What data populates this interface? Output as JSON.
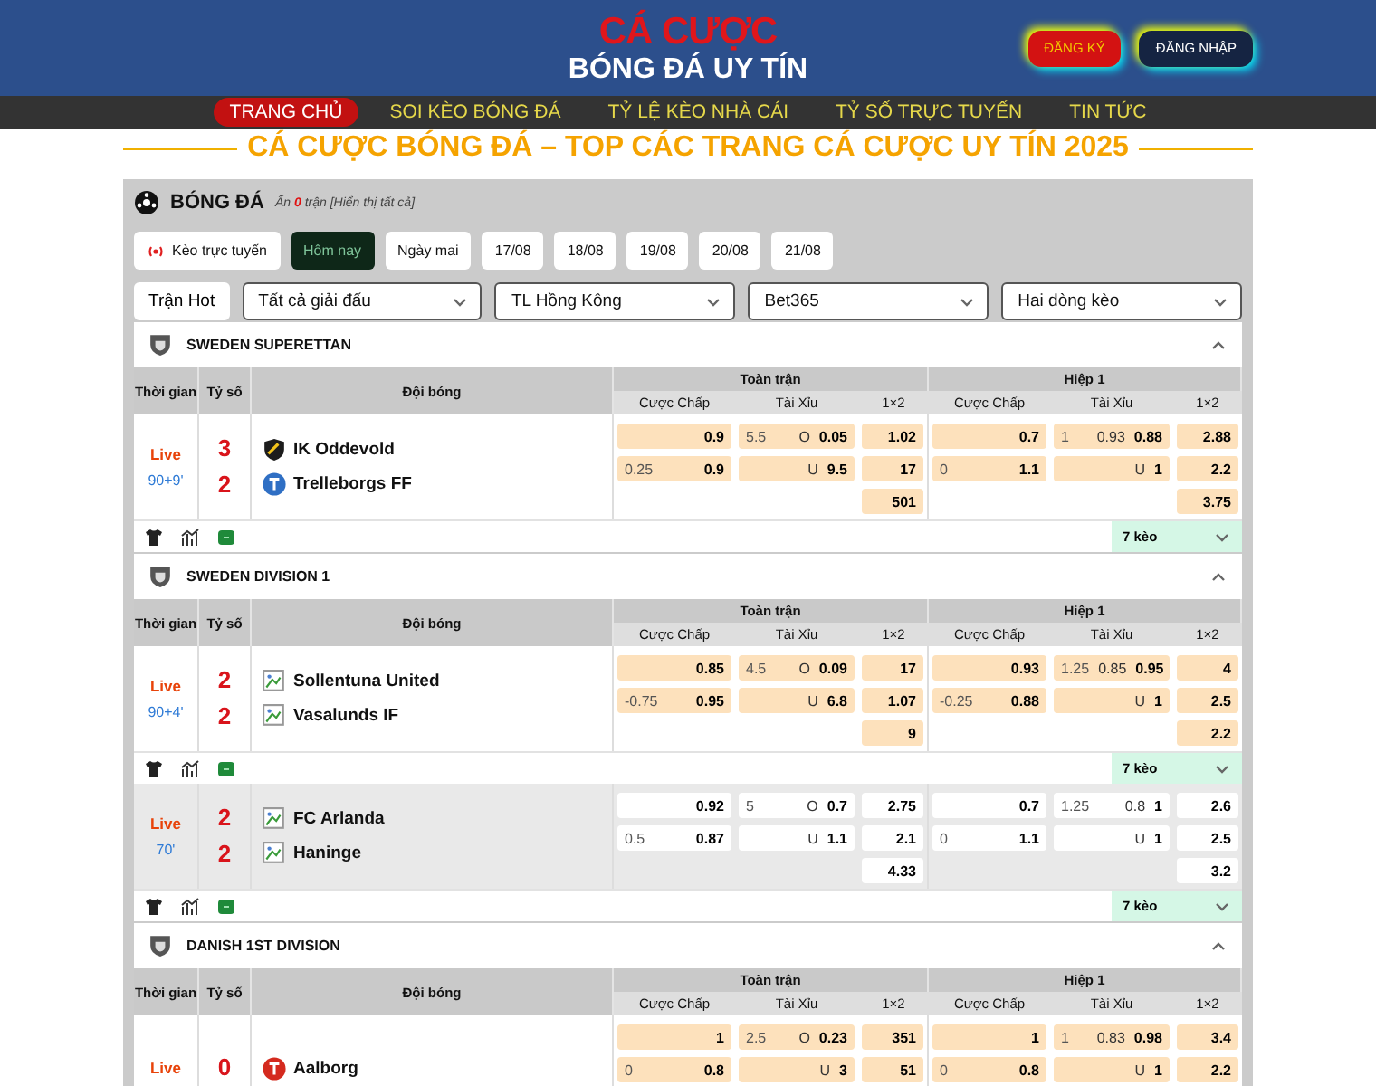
{
  "header": {
    "logo_top": "CÁ CƯỢC",
    "logo_bottom": "BÓNG ĐÁ UY TÍN",
    "buttons": [
      {
        "label": "ĐĂNG KÝ",
        "kind": "register"
      },
      {
        "label": "ĐĂNG NHẬP",
        "kind": "login"
      }
    ]
  },
  "nav": [
    {
      "label": "TRANG CHỦ",
      "selected": true
    },
    {
      "label": "SOI KÈO BÓNG ĐÁ",
      "selected": false
    },
    {
      "label": "TỶ LỆ KÈO NHÀ CÁI",
      "selected": false
    },
    {
      "label": "TỶ SỐ TRỰC TUYẾN",
      "selected": false
    },
    {
      "label": "TIN TỨC",
      "selected": false
    }
  ],
  "page_title": "CÁ CƯỢC BÓNG ĐÁ – TOP CÁC TRANG CÁ CƯỢC UY TÍN 2025",
  "sport": {
    "title": "BÓNG ĐÁ",
    "hidden_prefix": "Ẩn",
    "hidden_count": "0",
    "hidden_suffix": "trận [Hiển thị tất cả]"
  },
  "date_tabs": [
    {
      "label": "Kèo trực tuyến",
      "kind": "live",
      "selected": false
    },
    {
      "label": "Hôm nay",
      "kind": "date",
      "selected": true
    },
    {
      "label": "Ngày mai",
      "kind": "date",
      "selected": false
    },
    {
      "label": "17/08",
      "kind": "date",
      "selected": false
    },
    {
      "label": "18/08",
      "kind": "date",
      "selected": false
    },
    {
      "label": "19/08",
      "kind": "date",
      "selected": false
    },
    {
      "label": "20/08",
      "kind": "date",
      "selected": false
    },
    {
      "label": "21/08",
      "kind": "date",
      "selected": false
    }
  ],
  "filters": [
    {
      "label": "Trận Hot",
      "kind": "button"
    },
    {
      "label": "Tất cả giải đấu",
      "kind": "select"
    },
    {
      "label": "TL Hồng Kông",
      "kind": "select"
    },
    {
      "label": "Bet365",
      "kind": "select"
    },
    {
      "label": "Hai dòng kèo",
      "kind": "select"
    }
  ],
  "leagues": [
    {
      "name": "SWEDEN SUPERETTAN",
      "expanded": true,
      "columns": {
        "time": "Thời gian",
        "score": "Tỷ số",
        "teams": "Đội bóng",
        "full": "Toàn trận",
        "half": "Hiệp 1",
        "full_sub": [
          "Cược Chấp",
          "Tài Xỉu",
          "1×2"
        ],
        "half_sub": [
          "Cược Chấp",
          "Tài Xỉu",
          "1×2"
        ]
      },
      "matches": [
        {
          "status": "Live",
          "minute": "90+9'",
          "highlighted": true,
          "teams": [
            {
              "name": "IK Oddevold",
              "score": "3",
              "kind": "crest",
              "color": "#1c1c1c"
            },
            {
              "name": "Trelleborgs FF",
              "score": "2",
              "kind": "round",
              "color": "#2f6fc4"
            }
          ],
          "full": {
            "handicap": [
              {
                "odds": "0.9"
              },
              {
                "line": "0.25",
                "odds": "0.9"
              }
            ],
            "over_under": [
              {
                "line": "5.5",
                "mid": "O",
                "odds": "0.05"
              },
              {
                "mid": "U",
                "odds": "9.5"
              }
            ],
            "x12": [
              "1.02",
              "17",
              "501"
            ]
          },
          "half": {
            "handicap": [
              {
                "odds": "0.7"
              },
              {
                "line": "0",
                "odds": "1.1"
              }
            ],
            "over_under": [
              {
                "line": "1",
                "mid": "0.93",
                "odds": "0.88"
              },
              {
                "mid": "U",
                "odds": "1"
              }
            ],
            "x12": [
              "2.88",
              "2.2",
              "3.75"
            ]
          },
          "footer": {
            "markets": "7 kèo",
            "expanded": false
          }
        }
      ]
    },
    {
      "name": "SWEDEN DIVISION 1",
      "expanded": true,
      "columns": {
        "time": "Thời gian",
        "score": "Tỷ số",
        "teams": "Đội bóng",
        "full": "Toàn trận",
        "half": "Hiệp 1",
        "full_sub": [
          "Cược Chấp",
          "Tài Xỉu",
          "1×2"
        ],
        "half_sub": [
          "Cược Chấp",
          "Tài Xỉu",
          "1×2"
        ]
      },
      "matches": [
        {
          "status": "Live",
          "minute": "90+4'",
          "highlighted": true,
          "teams": [
            {
              "name": "Sollentuna United",
              "score": "2",
              "kind": "broken"
            },
            {
              "name": "Vasalunds IF",
              "score": "2",
              "kind": "broken"
            }
          ],
          "full": {
            "handicap": [
              {
                "odds": "0.85"
              },
              {
                "line": "-0.75",
                "odds": "0.95"
              }
            ],
            "over_under": [
              {
                "line": "4.5",
                "mid": "O",
                "odds": "0.09"
              },
              {
                "mid": "U",
                "odds": "6.8"
              }
            ],
            "x12": [
              "17",
              "1.07",
              "9"
            ]
          },
          "half": {
            "handicap": [
              {
                "odds": "0.93"
              },
              {
                "line": "-0.25",
                "odds": "0.88"
              }
            ],
            "over_under": [
              {
                "line": "1.25",
                "mid": "0.85",
                "odds": "0.95"
              },
              {
                "mid": "U",
                "odds": "1"
              }
            ],
            "x12": [
              "4",
              "2.5",
              "2.2"
            ]
          },
          "footer": {
            "markets": "7 kèo",
            "expanded": false
          }
        },
        {
          "status": "Live",
          "minute": "70'",
          "highlighted": false,
          "teams": [
            {
              "name": "FC Arlanda",
              "score": "2",
              "kind": "broken"
            },
            {
              "name": "Haninge",
              "score": "2",
              "kind": "broken"
            }
          ],
          "full": {
            "handicap": [
              {
                "odds": "0.92"
              },
              {
                "line": "0.5",
                "odds": "0.87"
              }
            ],
            "over_under": [
              {
                "line": "5",
                "mid": "O",
                "odds": "0.7"
              },
              {
                "mid": "U",
                "odds": "1.1"
              }
            ],
            "x12": [
              "2.75",
              "2.1",
              "4.33"
            ]
          },
          "half": {
            "handicap": [
              {
                "odds": "0.7"
              },
              {
                "line": "0",
                "odds": "1.1"
              }
            ],
            "over_under": [
              {
                "line": "1.25",
                "mid": "0.8",
                "odds": "1"
              },
              {
                "mid": "U",
                "odds": "1"
              }
            ],
            "x12": [
              "2.6",
              "2.5",
              "3.2"
            ]
          },
          "footer": {
            "markets": "7 kèo",
            "expanded": false
          }
        }
      ]
    },
    {
      "name": "DANISH 1ST DIVISION",
      "expanded": true,
      "columns": {
        "time": "Thời gian",
        "score": "Tỷ số",
        "teams": "Đội bóng",
        "full": "Toàn trận",
        "half": "Hiệp 1",
        "full_sub": [
          "Cược Chấp",
          "Tài Xỉu",
          "1×2"
        ],
        "half_sub": [
          "Cược Chấp",
          "Tài Xỉu",
          "1×2"
        ]
      },
      "matches": [
        {
          "status": "Live",
          "highlighted": true,
          "teams": [
            {
              "name": "Aalborg",
              "score": "0",
              "kind": "round",
              "color": "#d42a1e"
            }
          ],
          "full": {
            "handicap": [
              {
                "odds": "1"
              },
              {
                "line": "0",
                "odds": "0.8"
              }
            ],
            "over_under": [
              {
                "line": "2.5",
                "mid": "O",
                "odds": "0.23"
              },
              {
                "mid": "U",
                "odds": "3"
              }
            ],
            "x12": [
              "351",
              "51"
            ]
          },
          "half": {
            "handicap": [
              {
                "odds": "1"
              },
              {
                "line": "0",
                "odds": "0.8"
              }
            ],
            "over_under": [
              {
                "line": "1",
                "mid": "0.83",
                "odds": "0.98"
              },
              {
                "mid": "U",
                "odds": "1"
              }
            ],
            "x12": [
              "3.4",
              "2.2"
            ]
          }
        }
      ]
    }
  ]
}
